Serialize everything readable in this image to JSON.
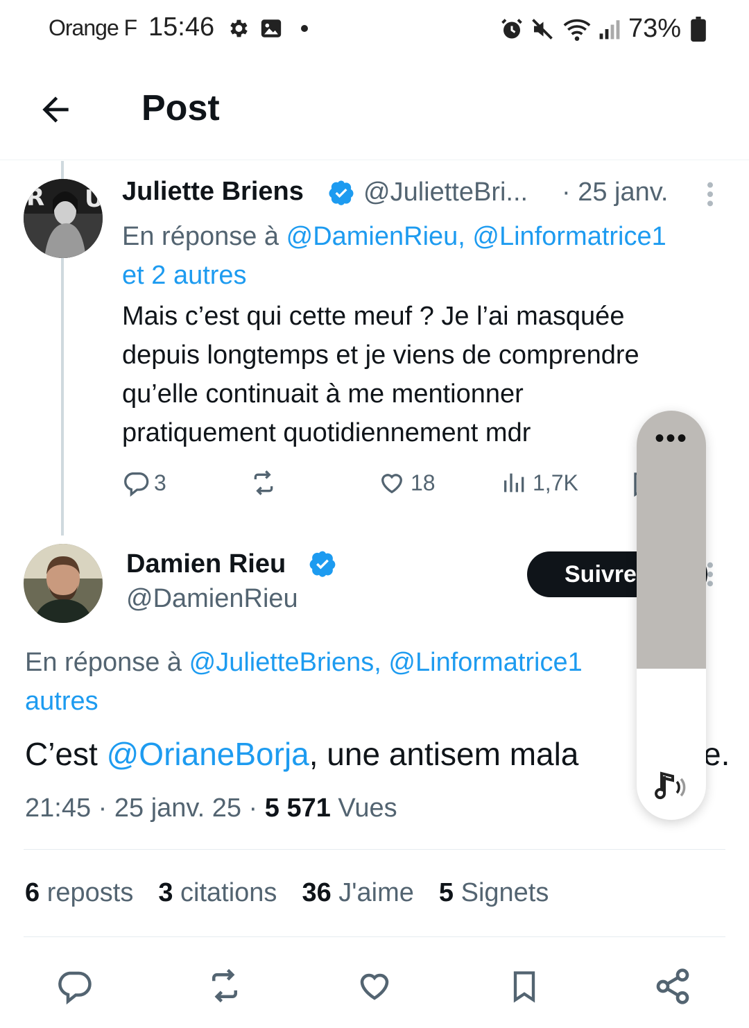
{
  "status_bar": {
    "carrier": "Orange F",
    "time": "15:46",
    "battery": "73%"
  },
  "header": {
    "title": "Post"
  },
  "reply_tweet": {
    "author_name": "Juliette Briens",
    "handle": "@JulietteBri...",
    "date": "· 25 janv.",
    "reply_prefix": "En réponse à",
    "reply_mentions": "@DamienRieu, @Linformatrice1",
    "reply_more": "et 2 autres",
    "text_lines": [
      "Mais c’est qui cette meuf ? Je l’ai masquée",
      "depuis longtemps et je viens de comprendre",
      "qu’elle continuait à me mentionner",
      "pratiquement quotidiennement mdr"
    ],
    "replies": "3",
    "likes": "18",
    "views": "1,7K"
  },
  "main_tweet": {
    "author_name": "Damien Rieu",
    "handle": "@DamienRieu",
    "follow_label": "Suivre",
    "reply_prefix": "En réponse à",
    "reply_mentions": "@JulietteBriens, @Linformatrice1",
    "reply_more": "autres",
    "text_prefix": "C’est ",
    "text_mention": "@OrianeBorja",
    "text_suffix": ", une antisem mala",
    "text_end": "e.",
    "time": "21:45",
    "date": "25 janv. 25",
    "views_count": "5 571",
    "views_label": "Vues"
  },
  "stats": {
    "reposts_count": "6",
    "reposts_label": "reposts",
    "quotes_count": "3",
    "quotes_label": "citations",
    "likes_count": "36",
    "likes_label": "J'aime",
    "bookmarks_count": "5",
    "bookmarks_label": "Signets"
  },
  "volume_overlay": {
    "menu_label": "•••",
    "level_percent": 37
  },
  "colors": {
    "accent": "#1d9bf0",
    "text": "#0f1419",
    "muted": "#536471"
  }
}
